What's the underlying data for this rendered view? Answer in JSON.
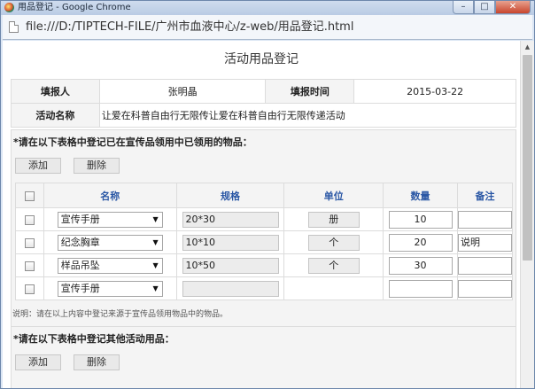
{
  "window": {
    "title": "用品登记 - Google Chrome",
    "minimize": "–",
    "restore": "□",
    "close": "✕"
  },
  "address": {
    "url": "file:///D:/TIPTECH-FILE/广州市血液中心/z-web/用品登记.html"
  },
  "page": {
    "title": "活动用品登记",
    "reporter_label": "填报人",
    "reporter_value": "张明晶",
    "time_label": "填报时间",
    "time_value": "2015-03-22",
    "activity_label": "活动名称",
    "activity_value": "让爱在科普自由行无限传让爱在科普自由行无限传递活动"
  },
  "section1": {
    "heading": "*请在以下表格中登记已在宣传品领用中已领用的物品：",
    "add_label": "添加",
    "delete_label": "删除",
    "columns": {
      "name": "名称",
      "spec": "规格",
      "unit": "单位",
      "qty": "数量",
      "note": "备注"
    },
    "rows": [
      {
        "name": "宣传手册",
        "spec": "20*30",
        "unit": "册",
        "qty": "10",
        "note": ""
      },
      {
        "name": "纪念胸章",
        "spec": "10*10",
        "unit": "个",
        "qty": "20",
        "note": "说明"
      },
      {
        "name": "样品吊坠",
        "spec": "10*50",
        "unit": "个",
        "qty": "30",
        "note": ""
      },
      {
        "name": "宣传手册",
        "spec": "",
        "unit": "",
        "qty": "",
        "note": ""
      }
    ],
    "explain": "说明：请在以上内容中登记来源于宣传品领用物品中的物品。"
  },
  "section2": {
    "heading": "*请在以下表格中登记其他活动用品：",
    "add_label": "添加",
    "delete_label": "删除"
  },
  "icons": {
    "caret": "▼",
    "scroll_up": "▲"
  }
}
